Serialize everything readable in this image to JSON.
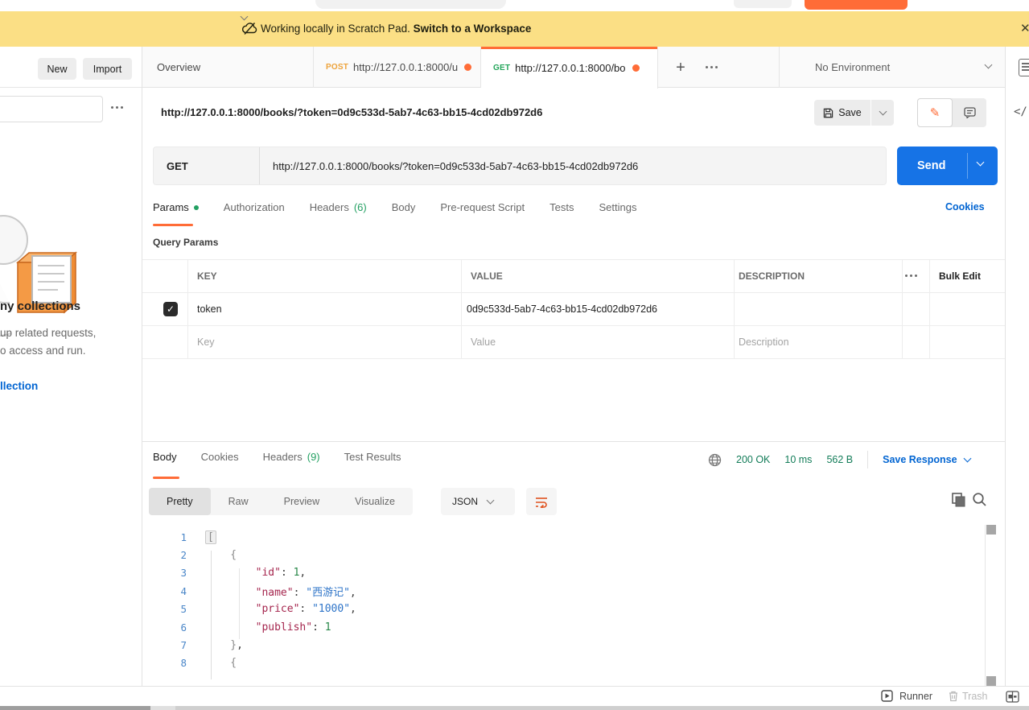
{
  "banner": {
    "text": "Working locally in Scratch Pad.",
    "link": "Switch to a Workspace",
    "close": "✕"
  },
  "sidebar": {
    "new_button": "New",
    "import_button": "Import",
    "empty_title": "ny collections",
    "empty_line1": "up related requests,",
    "empty_line2": "o access and run.",
    "create_link": "llection"
  },
  "tabstrip": {
    "overview_tab": "Overview",
    "post_tab": {
      "method": "POST",
      "url": "http://127.0.0.1:8000/u"
    },
    "get_tab": {
      "method": "GET",
      "url": "http://127.0.0.1:8000/bo"
    },
    "plus": "+",
    "environment": "No Environment"
  },
  "request": {
    "title_url": "http://127.0.0.1:8000/books/?token=0d9c533d-5ab7-4c63-bb15-4cd02db972d6",
    "save_label": "Save",
    "method": "GET",
    "url": "http://127.0.0.1:8000/books/?token=0d9c533d-5ab7-4c63-bb15-4cd02db972d6",
    "send_label": "Send",
    "tabs": [
      {
        "label": "Params",
        "dot": true,
        "active": true
      },
      {
        "label": "Authorization"
      },
      {
        "label": "Headers",
        "count": "(6)"
      },
      {
        "label": "Body"
      },
      {
        "label": "Pre-request Script"
      },
      {
        "label": "Tests"
      },
      {
        "label": "Settings"
      }
    ],
    "cookies_link": "Cookies",
    "query_params_label": "Query Params",
    "table": {
      "headers": [
        "KEY",
        "VALUE",
        "DESCRIPTION"
      ],
      "bulk_edit": "Bulk Edit",
      "rows": [
        {
          "checked": true,
          "key": "token",
          "value": "0d9c533d-5ab7-4c63-bb15-4cd02db972d6",
          "description": ""
        }
      ],
      "placeholders": {
        "key": "Key",
        "value": "Value",
        "description": "Description"
      }
    }
  },
  "response": {
    "tabs": [
      {
        "label": "Body",
        "active": true
      },
      {
        "label": "Cookies"
      },
      {
        "label": "Headers",
        "count": "(9)"
      },
      {
        "label": "Test Results"
      }
    ],
    "status": "200 OK",
    "time": "10 ms",
    "size": "562 B",
    "save_response_label": "Save Response",
    "view_tabs": [
      {
        "label": "Pretty",
        "active": true
      },
      {
        "label": "Raw"
      },
      {
        "label": "Preview"
      },
      {
        "label": "Visualize"
      }
    ],
    "format": "JSON",
    "code_lines": [
      {
        "num": "1",
        "t": [
          [
            "box",
            "["
          ]
        ]
      },
      {
        "num": "2",
        "t": [
          [
            "b",
            "    {"
          ]
        ]
      },
      {
        "num": "3",
        "t": [
          [
            "w",
            "        "
          ],
          [
            "k",
            "\"id\""
          ],
          [
            "p",
            ": "
          ],
          [
            "n",
            "1"
          ],
          [
            "p",
            ","
          ]
        ]
      },
      {
        "num": "4",
        "t": [
          [
            "w",
            "        "
          ],
          [
            "k",
            "\"name\""
          ],
          [
            "p",
            ": "
          ],
          [
            "s",
            "\"西游记\""
          ],
          [
            "p",
            ","
          ]
        ]
      },
      {
        "num": "5",
        "t": [
          [
            "w",
            "        "
          ],
          [
            "k",
            "\"price\""
          ],
          [
            "p",
            ": "
          ],
          [
            "s",
            "\"1000\""
          ],
          [
            "p",
            ","
          ]
        ]
      },
      {
        "num": "6",
        "t": [
          [
            "w",
            "        "
          ],
          [
            "k",
            "\"publish\""
          ],
          [
            "p",
            ": "
          ],
          [
            "n",
            "1"
          ]
        ]
      },
      {
        "num": "7",
        "t": [
          [
            "b",
            "    }"
          ],
          [
            "p",
            ","
          ]
        ]
      },
      {
        "num": "8",
        "t": [
          [
            "b",
            "    {"
          ]
        ]
      }
    ]
  },
  "footer": {
    "runner": "Runner",
    "trash": "Trash"
  }
}
